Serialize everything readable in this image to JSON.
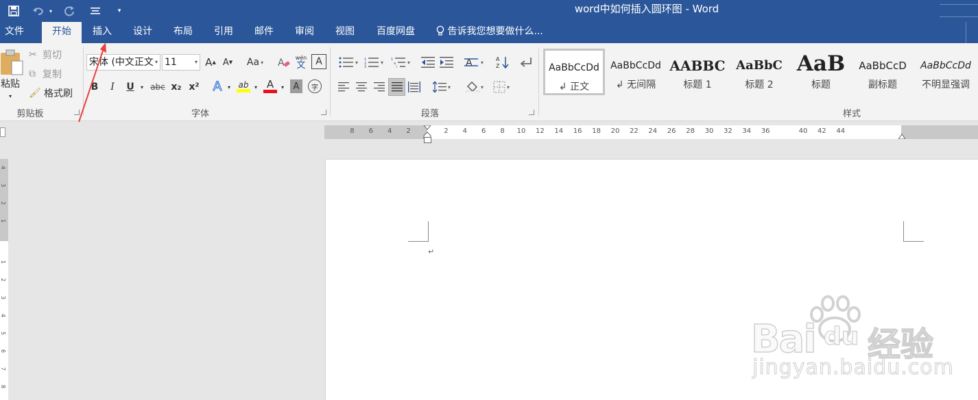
{
  "titlebar": {
    "title": "word中如何插入圆环图 - Word",
    "save_icon": "save-icon",
    "undo_icon": "undo-icon",
    "redo_icon": "redo-icon",
    "customize_icon": "customize-qat-icon"
  },
  "tabs": [
    {
      "label": "文件"
    },
    {
      "label": "开始",
      "active": true
    },
    {
      "label": "插入"
    },
    {
      "label": "设计"
    },
    {
      "label": "布局"
    },
    {
      "label": "引用"
    },
    {
      "label": "邮件"
    },
    {
      "label": "审阅"
    },
    {
      "label": "视图"
    },
    {
      "label": "百度网盘"
    }
  ],
  "tellme": {
    "text": "告诉我您想要做什么..."
  },
  "clipboard": {
    "paste": "粘贴",
    "cut": "剪切",
    "copy": "复制",
    "format_painter": "格式刷",
    "label": "剪贴板"
  },
  "font": {
    "name": "宋体 (中文正文",
    "size": "11",
    "label": "字体",
    "bold": "B",
    "italic": "I",
    "underline": "U",
    "strike": "abc",
    "sub": "x₂",
    "sup": "x²",
    "grow": "A",
    "shrink": "A",
    "case": "Aa",
    "phonetic_top": "wén",
    "phonetic_bottom": "文",
    "border_char": "A",
    "text_effect": "A",
    "highlight": "ab",
    "font_color": "A",
    "shade": "A",
    "enclose": "字",
    "font_color_hex": "#e81123",
    "highlight_hex": "#ffff00"
  },
  "paragraph": {
    "label": "段落"
  },
  "styles": {
    "label": "样式",
    "items": [
      {
        "preview": "AaBbCcDd",
        "name": "↲ 正文"
      },
      {
        "preview": "AaBbCcDd",
        "name": "↲ 无间隔"
      },
      {
        "preview": "AABBC",
        "name": "标题 1"
      },
      {
        "preview": "AaBbC",
        "name": "标题 2"
      },
      {
        "preview": "AaB",
        "name": "标题"
      },
      {
        "preview": "AaBbCcD",
        "name": "副标题"
      },
      {
        "preview": "AaBbCcDd",
        "name": "不明显强调"
      }
    ]
  },
  "ruler": {
    "left_labels": [
      "8",
      "6",
      "4",
      "2"
    ],
    "right_labels": [
      "2",
      "4",
      "6",
      "8",
      "10",
      "12",
      "14",
      "16",
      "18",
      "20",
      "22",
      "24",
      "26",
      "28",
      "30",
      "32",
      "34",
      "36",
      "40",
      "42",
      "44"
    ]
  },
  "document": {
    "paragraph_mark": "↵"
  },
  "watermark": {
    "brand": "Bai",
    "brand2": "du",
    "cn": "经验",
    "url": "jingyan.baidu.com"
  },
  "colors": {
    "ribbon_blue": "#2b579a",
    "ribbon_bg": "#f3f3f3",
    "arrow": "#e8413c"
  }
}
